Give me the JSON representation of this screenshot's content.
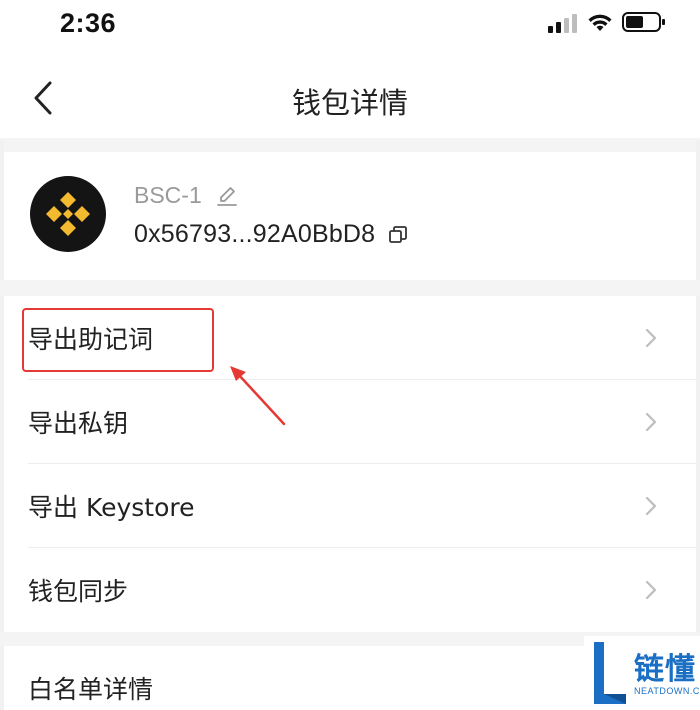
{
  "status_bar": {
    "time": "2:36"
  },
  "nav": {
    "title": "钱包详情"
  },
  "wallet": {
    "name": "BSC-1",
    "address": "0x56793...92A0BbD8",
    "logo_color": "#F3BA2F"
  },
  "menu": {
    "items": [
      {
        "label": "导出助记词"
      },
      {
        "label": "导出私钥"
      },
      {
        "label": "导出 Keystore"
      },
      {
        "label": "钱包同步"
      }
    ]
  },
  "menu_2": {
    "items": [
      {
        "label": "白名单详情"
      }
    ]
  },
  "annotation": {
    "color": "#E53935"
  },
  "watermark": {
    "text": "链懂",
    "sub": "NEATDOWN.COM",
    "color": "#1A6FC4"
  }
}
